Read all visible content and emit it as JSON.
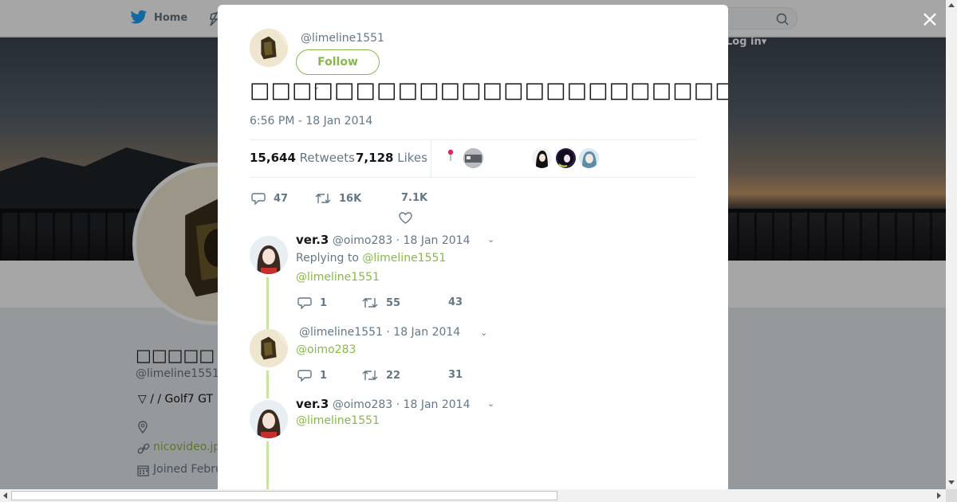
{
  "topbar": {
    "home_label": "Home",
    "login_label": "Log in",
    "login_caret": "▾"
  },
  "profile": {
    "name": "□□□□□",
    "handle": "@limeline1551",
    "bio": "▽ /  / Golf7 GT",
    "link": "nicovideo.jp",
    "joined": "Joined Febru"
  },
  "modal": {
    "close_label": "×",
    "author_handle": "@limeline1551",
    "follow_label": "Follow",
    "caret": "⌄",
    "tweet_text": "□□□□□□□□□□□□□□□□□□□□□□□□□□□□□□□□□□□□□□□□",
    "timestamp": "6:56 PM - 18 Jan 2014",
    "retweets_count": "15,644",
    "retweets_label": "Retweets",
    "likes_count": "7,128",
    "likes_label": "Likes",
    "actions": {
      "replies": "47",
      "retweets": "16K",
      "likes": "7.1K"
    }
  },
  "replies": [
    {
      "name": "ver.3",
      "handle": "@oimo283",
      "date": "· 18 Jan 2014",
      "replying_to_prefix": "Replying to",
      "replying_to": "@limeline1551",
      "text": "@limeline1551",
      "replies": "1",
      "retweets": "55",
      "likes": "43"
    },
    {
      "name": "",
      "handle": "@limeline1551",
      "date": "· 18 Jan 2014",
      "text": "@oimo283",
      "replies": "1",
      "retweets": "22",
      "likes": "31"
    },
    {
      "name": "ver.3",
      "handle": "@oimo283",
      "date": "· 18 Jan 2014",
      "text": "@limeline1551"
    }
  ],
  "colors": {
    "accent": "#88b84a",
    "thread_line": "#c8e49e",
    "muted": "#657786",
    "twitter_blue": "#1da1f2"
  }
}
